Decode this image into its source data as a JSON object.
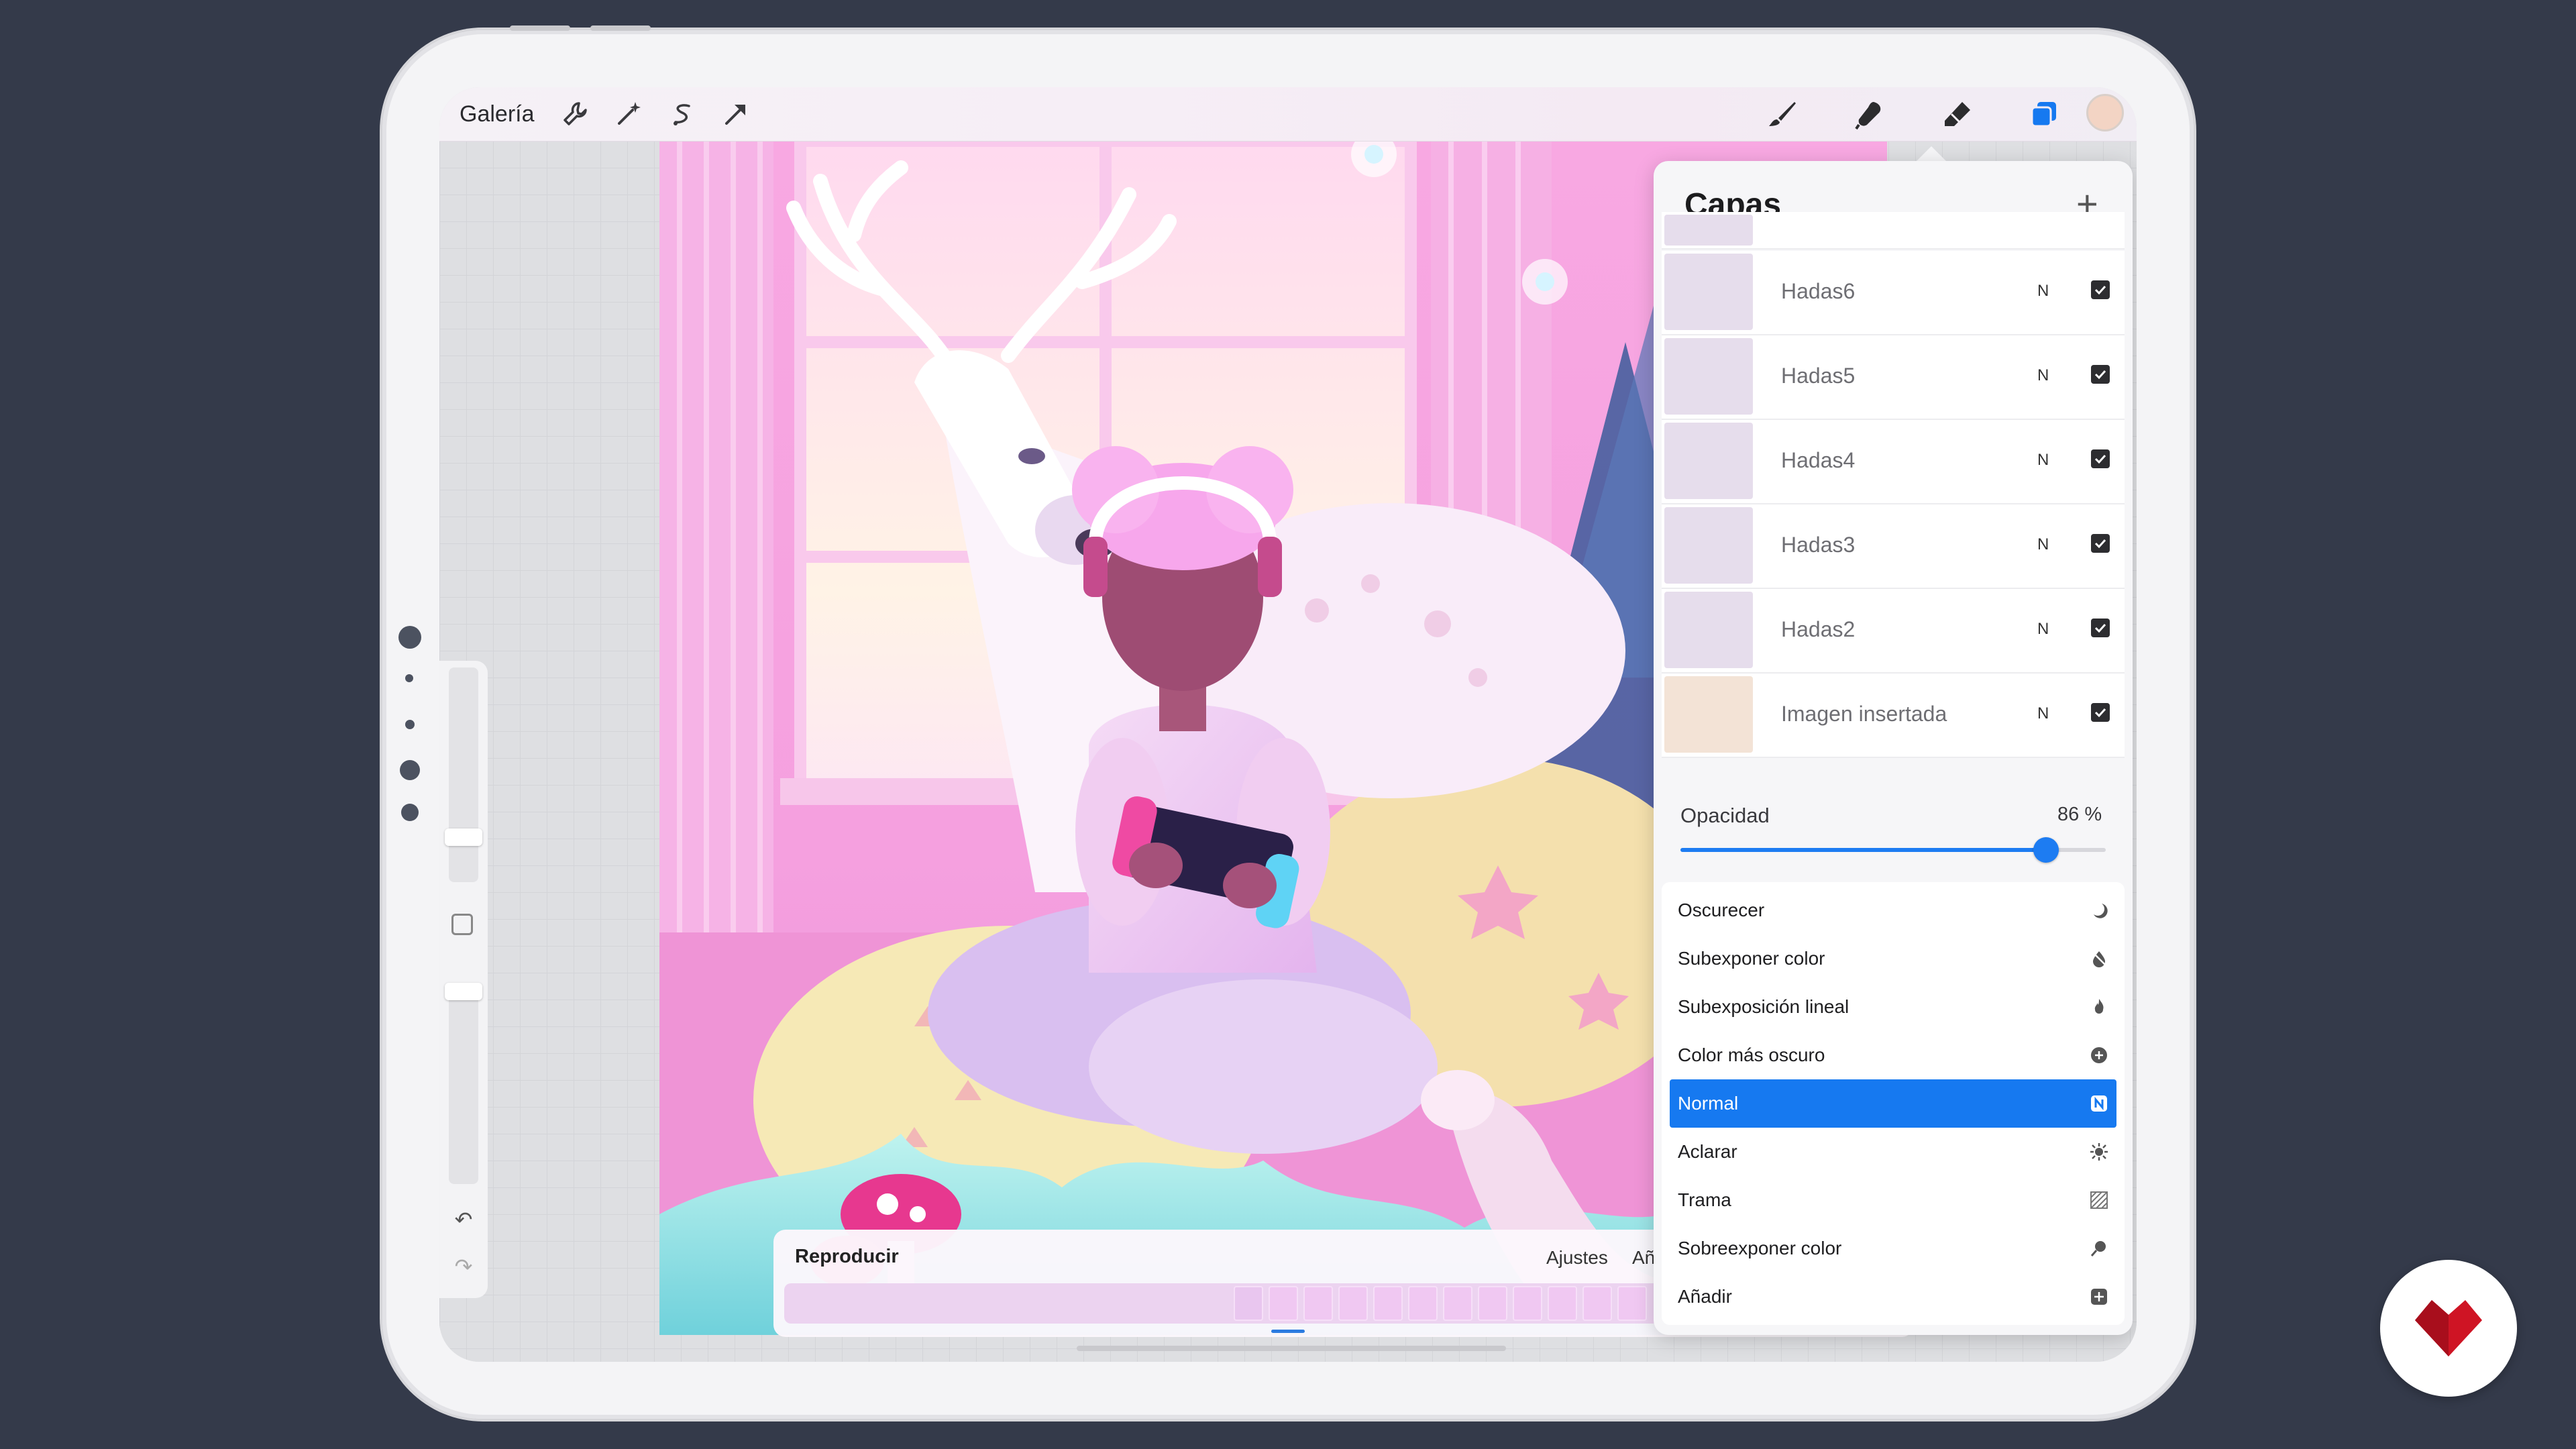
{
  "toolbar": {
    "gallery_label": "Galería",
    "left_icons": [
      "wrench-icon",
      "magic-wand-icon",
      "selection-icon",
      "transform-arrow-icon"
    ],
    "right_icons": [
      "brush-icon",
      "smudge-icon",
      "eraser-icon",
      "layers-icon"
    ],
    "active_tool": "layers",
    "active_color": "#f3d4c4",
    "accent": "#1679f0"
  },
  "layers_panel": {
    "title": "Capas",
    "add_icon": "plus-icon",
    "layers": [
      {
        "name": "Hadas6",
        "mode": "N",
        "visible": true
      },
      {
        "name": "Hadas5",
        "mode": "N",
        "visible": true
      },
      {
        "name": "Hadas4",
        "mode": "N",
        "visible": true
      },
      {
        "name": "Hadas3",
        "mode": "N",
        "visible": true
      },
      {
        "name": "Hadas2",
        "mode": "N",
        "visible": true
      },
      {
        "name": "Imagen insertada",
        "mode": "N",
        "visible": true
      }
    ],
    "opacity_label": "Opacidad",
    "opacity_value": "86 %",
    "opacity_fraction": 0.86,
    "blend_modes": [
      {
        "label": "Oscurecer",
        "icon": "moon-icon",
        "selected": false
      },
      {
        "label": "Subexponer color",
        "icon": "burn-drop-icon",
        "selected": false
      },
      {
        "label": "Subexposición lineal",
        "icon": "flame-icon",
        "selected": false
      },
      {
        "label": "Color más oscuro",
        "icon": "plus-circle-icon",
        "selected": false
      },
      {
        "label": "Normal",
        "icon": "n-badge-icon",
        "selected": true
      },
      {
        "label": "Aclarar",
        "icon": "sun-icon",
        "selected": false
      },
      {
        "label": "Trama",
        "icon": "hatch-icon",
        "selected": false
      },
      {
        "label": "Sobreexponer color",
        "icon": "dodge-icon",
        "selected": false
      },
      {
        "label": "Añadir",
        "icon": "plus-square-icon",
        "selected": false
      }
    ]
  },
  "animation": {
    "play_label": "Reproducir",
    "settings_label": "Ajustes",
    "more_label": "Añ"
  },
  "sidebar": {
    "modify_icon": "square-icon",
    "undo_icon": "undo-icon",
    "redo_icon": "redo-icon"
  }
}
